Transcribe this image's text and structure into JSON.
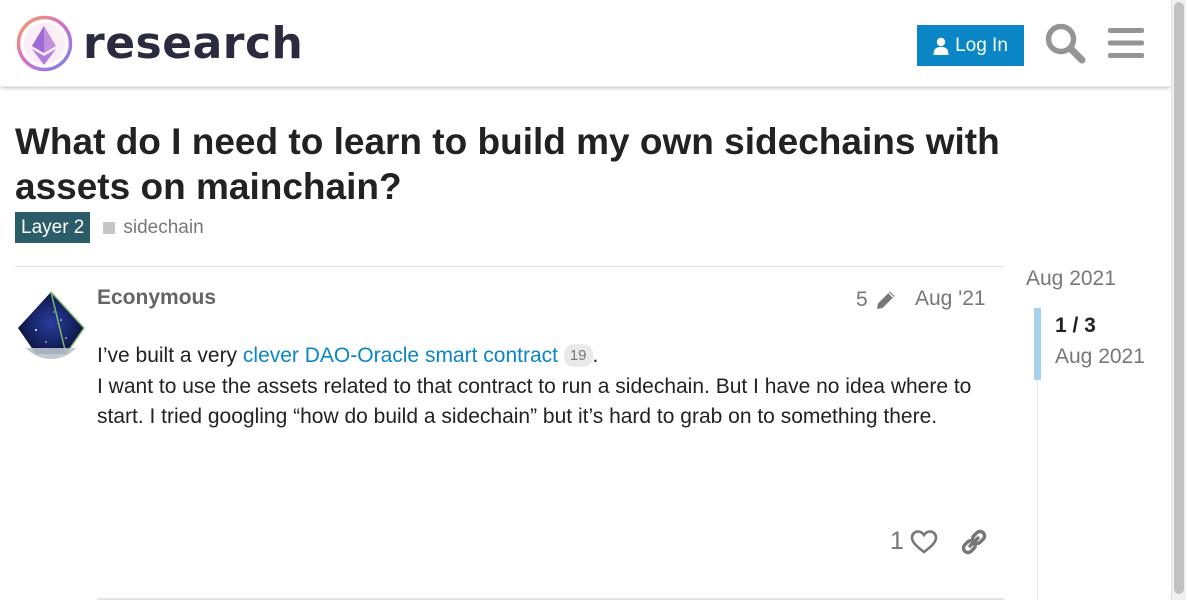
{
  "header": {
    "site_name": "research",
    "login_label": "Log In",
    "icons": [
      "user-icon",
      "search-icon",
      "hamburger-menu-icon"
    ]
  },
  "topic": {
    "title": "What do I need to learn to build my own sidechains with assets on mainchain?",
    "category": "Layer 2",
    "tags": [
      "sidechain"
    ],
    "category_color": "#2b5d68"
  },
  "post": {
    "author": "Econymous",
    "edit_count": "5",
    "date": "Aug '21",
    "body_prefix": "I’ve built a very ",
    "link_text": "clever DAO-Oracle smart contract",
    "link_clicks": "19",
    "body_after_link": ".",
    "body_rest": "I want to use the assets related to that contract to run a sidechain. But I have no idea where to start. I tried googling “how do build a sidechain” but it’s hard to grab on to something there.",
    "like_count": "1"
  },
  "timeline": {
    "start_date": "Aug 2021",
    "position": "1 / 3",
    "current_date": "Aug 2021"
  },
  "colors": {
    "accent": "#0a86c6",
    "timeline_handle": "#a6d1ea"
  }
}
